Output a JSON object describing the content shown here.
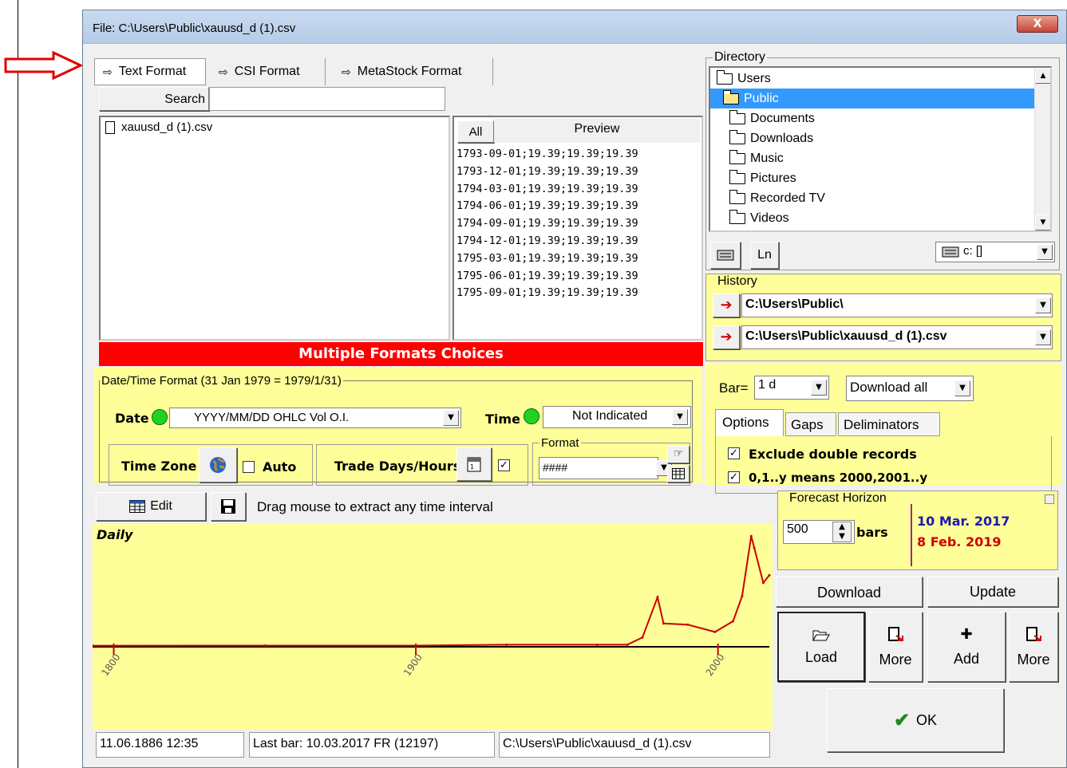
{
  "window": {
    "title": "File: C:\\Users\\Public\\xauusd_d (1).csv",
    "close_label": "X"
  },
  "tabs": [
    {
      "label": "Text Format",
      "active": true
    },
    {
      "label": "CSI Format",
      "active": false
    },
    {
      "label": "MetaStock Format",
      "active": false
    }
  ],
  "search": {
    "label": "Search",
    "value": ""
  },
  "files": [
    {
      "name": "xauusd_d (1).csv"
    }
  ],
  "preview": {
    "all_label": "All",
    "title": "Preview",
    "lines": [
      "1793-09-01;19.39;19.39;19.39",
      "1793-12-01;19.39;19.39;19.39",
      "1794-03-01;19.39;19.39;19.39",
      "1794-06-01;19.39;19.39;19.39",
      "1794-09-01;19.39;19.39;19.39",
      "1794-12-01;19.39;19.39;19.39",
      "1795-03-01;19.39;19.39;19.39",
      "1795-06-01;19.39;19.39;19.39",
      "1795-09-01;19.39;19.39;19.39"
    ]
  },
  "banner": {
    "text": "Multiple Formats Choices",
    "color": "#ff0000"
  },
  "datetime": {
    "legend": "Date/Time Format (31 Jan 1979  =  1979/1/31)",
    "date_label": "Date",
    "date_value": "YYYY/MM/DD  OHLC Vol O.I.",
    "time_label": "Time",
    "time_value": "Not Indicated",
    "timezone_label": "Time Zone",
    "auto_label": "Auto",
    "auto_checked": false,
    "tradedays_label": "Trade Days/Hours",
    "tradedays_checked": true,
    "format_legend": "Format",
    "format_value": "####"
  },
  "toolbar": {
    "edit_label": "Edit",
    "hint": "Drag mouse to extract any time interval"
  },
  "chart_data": {
    "type": "line",
    "title": "Daily",
    "x_ticks": [
      "1800",
      "1900",
      "2000"
    ],
    "xlim": [
      1793,
      2017
    ],
    "series": [
      {
        "x": [
          1793,
          1850,
          1900,
          1930,
          1960,
          1970,
          1975,
          1980,
          1982,
          1990,
          1999,
          2005,
          2008,
          2011,
          2012,
          2015,
          2017
        ],
        "values": [
          19.39,
          20.67,
          20.67,
          35,
          35,
          36,
          160,
          850,
          400,
          380,
          255,
          440,
          870,
          1900,
          1700,
          1100,
          1230
        ],
        "color": "#cc0000"
      }
    ]
  },
  "status": {
    "cursor": "11.06.1886  12:35",
    "last_bar": "Last bar: 10.03.2017 FR (12197)",
    "path": "C:\\Users\\Public\\xauusd_d (1).csv"
  },
  "directory": {
    "legend": "Directory",
    "items": [
      {
        "name": "Users",
        "level": 0,
        "open": true,
        "selected": false
      },
      {
        "name": "Public",
        "level": 1,
        "open": true,
        "selected": true
      },
      {
        "name": "Documents",
        "level": 2,
        "open": false,
        "selected": false
      },
      {
        "name": "Downloads",
        "level": 2,
        "open": false,
        "selected": false
      },
      {
        "name": "Music",
        "level": 2,
        "open": false,
        "selected": false
      },
      {
        "name": "Pictures",
        "level": 2,
        "open": false,
        "selected": false
      },
      {
        "name": "Recorded TV",
        "level": 2,
        "open": false,
        "selected": false
      },
      {
        "name": "Videos",
        "level": 2,
        "open": false,
        "selected": false
      }
    ],
    "ln_label": "Ln",
    "drive_value": "c: []"
  },
  "history": {
    "legend": "History",
    "entries": [
      "C:\\Users\\Public\\",
      "C:\\Users\\Public\\xauusd_d (1).csv"
    ]
  },
  "bar": {
    "label": "Bar=",
    "value": "1 d",
    "download_value": "Download all"
  },
  "options_tabs": [
    "Options",
    "Gaps",
    "Deliminators"
  ],
  "options": {
    "exclude_double": {
      "label": "Exclude double records",
      "checked": true
    },
    "year_mapping": {
      "label": "0,1..y means 2000,2001..y",
      "checked": true
    }
  },
  "forecast": {
    "legend": "Forecast Horizon",
    "value": "500",
    "unit": "bars",
    "date1": "10 Mar. 2017",
    "date2": "8 Feb. 2019",
    "date1_color": "#1a1aaa",
    "date2_color": "#cc0000"
  },
  "actions": {
    "download": "Download",
    "update": "Update",
    "load": "Load",
    "more1": "More",
    "add": "Add",
    "more2": "More",
    "ok": "OK"
  }
}
